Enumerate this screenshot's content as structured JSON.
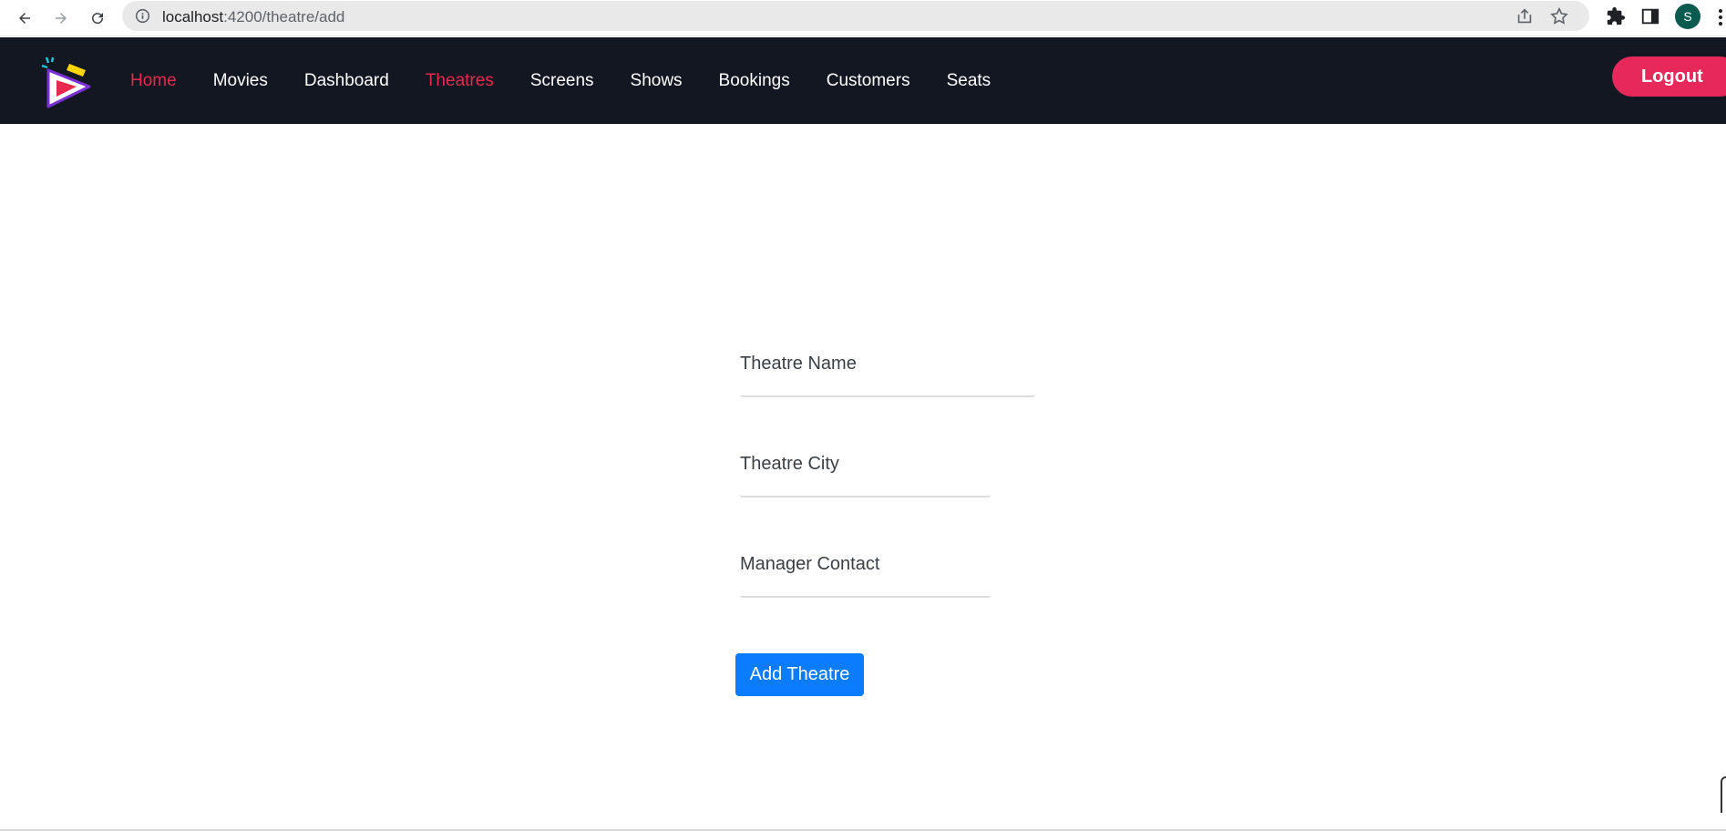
{
  "browser": {
    "url_host": "localhost",
    "url_rest": ":4200/theatre/add",
    "profile_initial": "S",
    "icons": [
      "back-arrow-icon",
      "forward-arrow-icon",
      "reload-icon",
      "info-icon",
      "share-icon",
      "star-icon",
      "puzzle-icon",
      "side-panel-icon",
      "kebab-menu-icon"
    ]
  },
  "navbar": {
    "links": [
      {
        "label": "Home",
        "active": true
      },
      {
        "label": "Movies",
        "active": false
      },
      {
        "label": "Dashboard",
        "active": false
      },
      {
        "label": "Theatres",
        "active": true
      },
      {
        "label": "Screens",
        "active": false
      },
      {
        "label": "Shows",
        "active": false
      },
      {
        "label": "Bookings",
        "active": false
      },
      {
        "label": "Customers",
        "active": false
      },
      {
        "label": "Seats",
        "active": false
      }
    ],
    "logout_label": "Logout"
  },
  "form": {
    "theatre_name_placeholder": "Theatre Name",
    "theatre_city_placeholder": "Theatre City",
    "manager_contact_placeholder": "Manager Contact",
    "submit_label": "Add Theatre"
  },
  "colors": {
    "navbar_bg": "#131722",
    "accent": "#e8284f",
    "logout_bg": "#e6295a",
    "submit_bg": "#0a7cff"
  }
}
